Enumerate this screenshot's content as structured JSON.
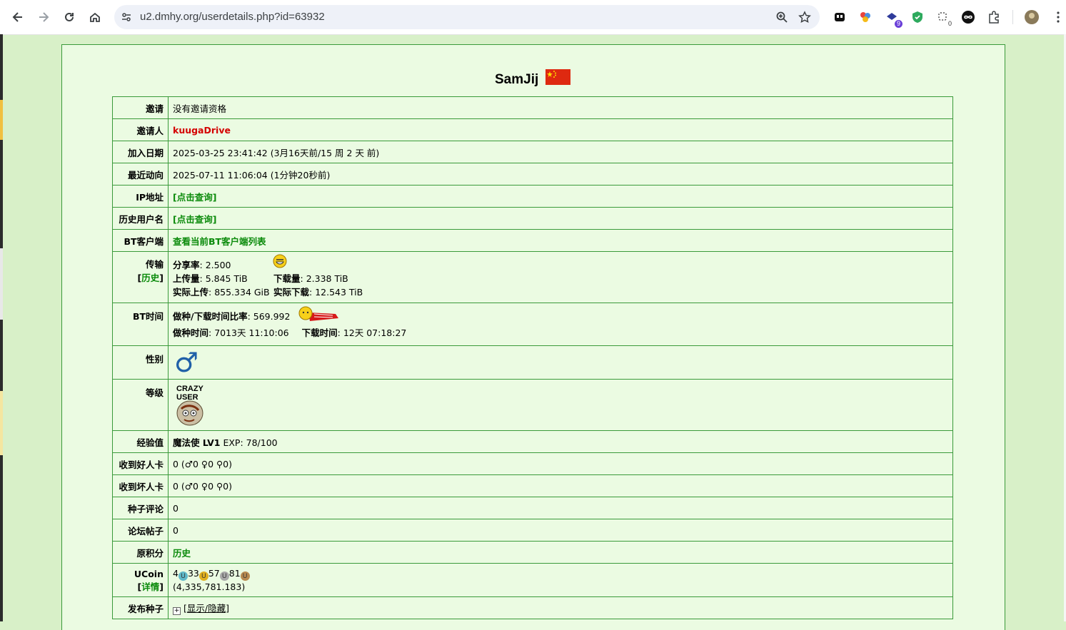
{
  "browser": {
    "url": "u2.dmhy.org/userdetails.php?id=63932",
    "extension_badges": {
      "ext3": "9",
      "ext5": "0"
    }
  },
  "profile": {
    "username": "SamJij"
  },
  "rows": {
    "invite": {
      "label": "邀请",
      "value": "没有邀请资格"
    },
    "inviter": {
      "label": "邀请人",
      "value": "kuugaDrive"
    },
    "joined": {
      "label": "加入日期",
      "value": "2025-03-25 23:41:42 (3月16天前/15 周 2 天 前)"
    },
    "last_seen": {
      "label": "最近动向",
      "value": "2025-07-11 11:06:04 (1分钟20秒前)"
    },
    "ip": {
      "label": "IP地址",
      "value": "[点击查询]"
    },
    "history_names": {
      "label": "历史用户名",
      "value": "[点击查询]"
    },
    "bt_client": {
      "label": "BT客户端",
      "value": "查看当前BT客户端列表"
    },
    "transfer": {
      "label": "传输",
      "history_link": "历史",
      "ratio_label": "分享率",
      "ratio": ": 2.500",
      "uploaded_label": "上传量",
      "uploaded": ": 5.845 TiB",
      "downloaded_label": "下载量",
      "downloaded": ": 2.338 TiB",
      "real_up_label": "实际上传",
      "real_up": ": 855.334 GiB",
      "real_down_label": "实际下载",
      "real_down": ": 12.543 TiB"
    },
    "bt_time": {
      "label": "BT时间",
      "ratio_label": "做种/下载时间比率",
      "ratio": ": 569.992",
      "seed_label": "做种时间",
      "seed": ": 7013天 11:10:06",
      "leech_label": "下载时间",
      "leech": ": 12天 07:18:27"
    },
    "gender": {
      "label": "性别",
      "symbol": "♂"
    },
    "class": {
      "label": "等级",
      "badge_line1": "CRAZY",
      "badge_line2": "USER"
    },
    "exp": {
      "label": "经验值",
      "title": "魔法使 LV1",
      "exp": "EXP: 78/100"
    },
    "good_cards": {
      "label": "收到好人卡",
      "value": "0 (♂0 ♀0 ⚲0)"
    },
    "bad_cards": {
      "label": "收到坏人卡",
      "value": "0 (♂0 ♀0 ⚲0)"
    },
    "torrent_comments": {
      "label": "种子评论",
      "value": "0"
    },
    "forum_posts": {
      "label": "论坛帖子",
      "value": "0"
    },
    "original_points": {
      "label": "原积分",
      "value": "历史"
    },
    "ucoin": {
      "label": "UCoin",
      "detail_link": "详情",
      "n1": "4",
      "n2": "33",
      "n3": "57",
      "n4": "81",
      "total": "(4,335,781.183)"
    },
    "uploads": {
      "label": "发布种子",
      "value": "[显示/隐藏]"
    }
  },
  "colors": {
    "page_bg": "#d8f0c8",
    "panel_bg": "#ebfbe2",
    "border": "#3a9a3a",
    "link_green": "#0a8a0a",
    "link_red": "#d40000"
  }
}
